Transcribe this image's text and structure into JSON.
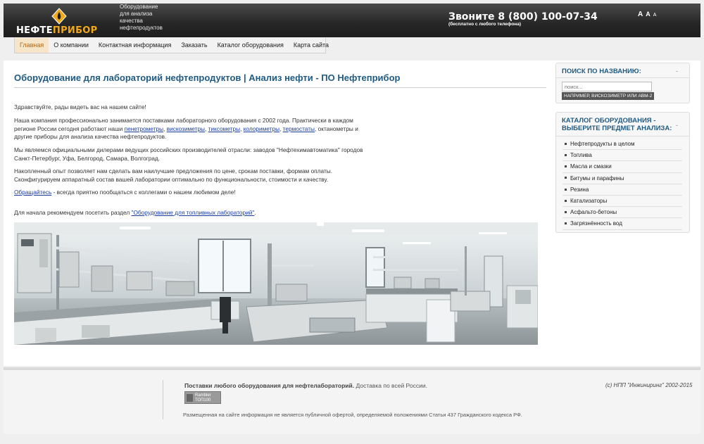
{
  "header": {
    "logo_part1": "НЕФТЕ",
    "logo_part2": "ПРИБОР",
    "slogan": "Оборудование для анализа качества нефтепродуктов",
    "phone": "Звоните 8 (800) 100-07-34",
    "phone_note": "(бесплатно с любого телефона)",
    "font_large": "A",
    "font_medium": "A",
    "font_small": "A"
  },
  "nav": {
    "items": [
      "Главная",
      "О компании",
      "Контактная информация",
      "Заказать",
      "Каталог оборудования",
      "Карта сайта"
    ]
  },
  "content": {
    "title": "Оборудование для лабораторий нефтепродуктов | Анализ нефти - ПО Нефтеприбор",
    "greeting": "Здравствуйте, рады видеть вас на нашем сайте!",
    "about_prefix": "Наша компания профессионально занимается поставками лабораторного оборудования с 2002 года. Практически в каждом регионе России сегодня работают наши ",
    "about_links": [
      "пенетрометры",
      "вискозиметры",
      "тиксометры",
      "колориметры",
      "термостаты"
    ],
    "about_suffix": " октанометры и другие приборы для анализа качества нефтепродуктов.",
    "dealers": "Мы являемся официальными дилерами ведущих российских производителей отрасли: заводов \"Нефтехимавтоматика\" городов Санкт-Петербург, Уфа, Белгород, Самара, Волгоград.",
    "offer": "Накопленный опыт позволяет нам сделать вам наилучшие предложения по цене, срокам поставки, формам оплаты. Сконфигурируем аппаратный состав вашей лаборатории оптимально по функциональности, стоимости и качеству.",
    "contact_link": "Обращайтесь",
    "contact_text": " - всегда приятно пообщаться с коллегами о нашем любимом деле!",
    "recommend_prefix": "Для начала рекомендуем посетить раздел ",
    "recommend_link": "\"Оборудование для топливных лабораторий\"",
    "recommend_suffix": "."
  },
  "sidebar": {
    "search": {
      "title": "ПОИСК ПО НАЗВАНИЮ:",
      "toggle": "-",
      "placeholder": "поиск...",
      "hint": "НАПРИМЕР, ВИСКОЗИМЕТР ИЛИ АВМ-2"
    },
    "catalog": {
      "title_line1": "КАТАЛОГ ОБОРУДОВАНИЯ -",
      "title_line2": "ВЫБЕРИТЕ ПРЕДМЕТ АНАЛИЗА:",
      "toggle": "-",
      "items": [
        "Нефтепродукты в целом",
        "Топлива",
        "Масла и смазки",
        "Битумы и парафины",
        "Резина",
        "Катализаторы",
        "Асфальто-бетоны",
        "Загрязнённость вод"
      ]
    }
  },
  "footer": {
    "main_bold": "Поставки любого оборудования для нефтелабораторий.",
    "main_text": " Доставка по всей России.",
    "copyright": "(с) НПП \"Инжиниринг\" 2002-2015",
    "counter_line1": "Rambler",
    "counter_line2": "ТОП100",
    "disclaimer": "Размещенная на сайте информация не является публичной офертой, определяемой положениями Статьи 437 Гражданского кодекса РФ."
  },
  "colors": {
    "accent_orange": "#f0a81c",
    "title_blue": "#1f5a82",
    "link_blue": "#1a3d9e"
  }
}
